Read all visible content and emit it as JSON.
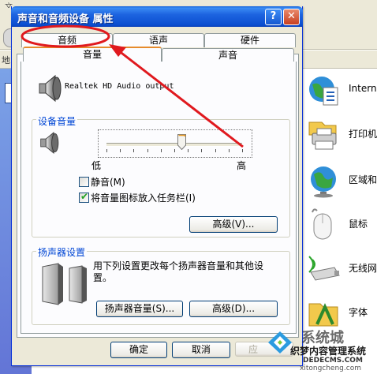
{
  "background_window": {
    "menu_fragment": "文",
    "address_label": "地",
    "control_panel_items": [
      {
        "label": "Intern",
        "icon": "globe-internet-icon"
      },
      {
        "label": "打印机",
        "icon": "printer-icon"
      },
      {
        "label": "区域和",
        "icon": "globe-region-icon"
      },
      {
        "label": "鼠标",
        "icon": "mouse-icon"
      },
      {
        "label": "无线网",
        "icon": "wireless-network-icon"
      },
      {
        "label": "字体",
        "icon": "fonts-folder-icon"
      }
    ]
  },
  "dialog": {
    "title": "声音和音频设备 属性",
    "help_button": "?",
    "close_button": "✕",
    "tabs_row_back": [
      "音频",
      "语声",
      "硬件"
    ],
    "tabs_row_front": [
      "音量",
      "声音"
    ],
    "active_tab": "音量",
    "device_name": "Realtek HD Audio output",
    "device_volume": {
      "group_title": "设备音量",
      "slider_min_label": "低",
      "slider_max_label": "高",
      "slider_level_percent": 55,
      "mute_label": "静音(M)",
      "mute_checked": false,
      "taskbar_icon_label": "将音量图标放入任务栏(I)",
      "taskbar_icon_checked": true,
      "advanced_button": "高级(V)..."
    },
    "speaker_settings": {
      "group_title": "扬声器设置",
      "description": "用下列设置更改每个扬声器音量和其他设置。",
      "speaker_volume_button": "扬声器音量(S)...",
      "advanced_button": "高级(D)..."
    },
    "footer": {
      "ok_button": "确定",
      "cancel_button": "取消",
      "apply_button": "应"
    }
  },
  "annotation": {
    "color": "#e0191e"
  },
  "watermark": {
    "line1": "系统城",
    "line2": "织梦内容管理系统",
    "line3": "DEDECMS.COM",
    "line4": "xitongcheng.com"
  }
}
